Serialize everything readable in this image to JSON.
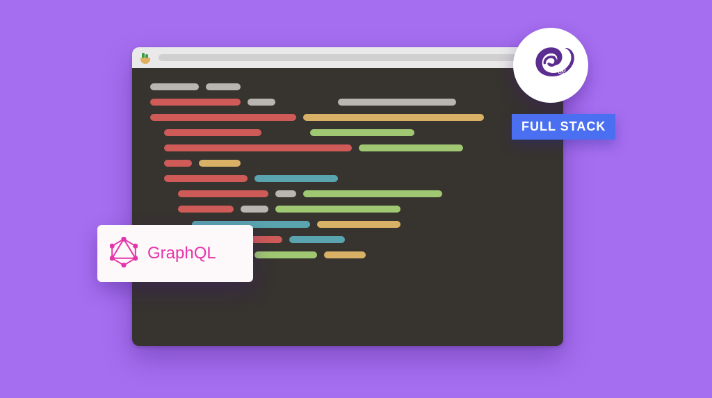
{
  "badges": {
    "technology_tag": "FULL STACK",
    "graphql_label": "GraphQL"
  },
  "colors": {
    "background": "#a56ef0",
    "editor_bg": "#37332f",
    "blazor_purple": "#5c2d91",
    "graphql_pink": "#e535ab",
    "tag_blue": "#4a6ff0"
  },
  "code_lines": [
    {
      "indent": 0,
      "segs": [
        [
          "gray",
          70
        ],
        [
          "gray",
          50
        ]
      ]
    },
    {
      "indent": 0,
      "segs": [
        [
          "red",
          130
        ],
        [
          "gray",
          40
        ],
        [
          "gray-gap",
          70
        ],
        [
          "gray",
          170
        ]
      ]
    },
    {
      "indent": 0,
      "segs": [
        [
          "red",
          210
        ],
        [
          "yellow",
          260
        ]
      ]
    },
    {
      "indent": 1,
      "segs": [
        [
          "red",
          140
        ],
        [
          "green-gap",
          50
        ],
        [
          "green",
          150
        ]
      ]
    },
    {
      "indent": 1,
      "segs": [
        [
          "red",
          270
        ],
        [
          "green",
          150
        ]
      ]
    },
    {
      "indent": 1,
      "segs": [
        [
          "red",
          40
        ],
        [
          "yellow",
          60
        ]
      ]
    },
    {
      "indent": 1,
      "segs": [
        [
          "red",
          120
        ],
        [
          "teal",
          120
        ]
      ]
    },
    {
      "indent": 2,
      "segs": [
        [
          "red",
          130
        ],
        [
          "gray",
          30
        ],
        [
          "green",
          200
        ]
      ]
    },
    {
      "indent": 2,
      "segs": [
        [
          "red",
          80
        ],
        [
          "gray",
          40
        ],
        [
          "green",
          180
        ]
      ]
    },
    {
      "indent": 3,
      "segs": [
        [
          "teal",
          170
        ],
        [
          "yellow",
          120
        ]
      ]
    },
    {
      "indent": 2,
      "segs": [
        [
          "red",
          150
        ],
        [
          "teal",
          80
        ]
      ]
    },
    {
      "indent": 2,
      "segs": [
        [
          "red",
          100
        ],
        [
          "green",
          90
        ],
        [
          "yellow",
          60
        ]
      ]
    }
  ]
}
